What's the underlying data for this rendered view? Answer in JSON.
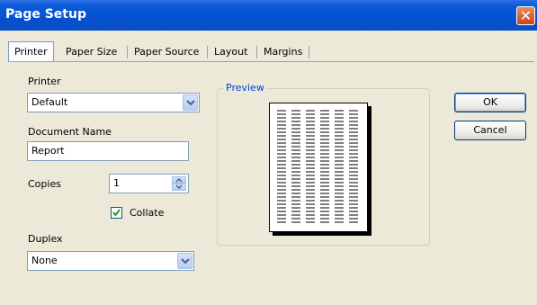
{
  "window": {
    "title": "Page Setup",
    "close_glyph": "✕"
  },
  "tabs": [
    {
      "label": "Printer",
      "active": true
    },
    {
      "label": "Paper Size",
      "active": false
    },
    {
      "label": "Paper Source",
      "active": false
    },
    {
      "label": "Layout",
      "active": false
    },
    {
      "label": "Margins",
      "active": false
    }
  ],
  "printer": {
    "label": "Printer",
    "selected": "Default"
  },
  "document_name": {
    "label": "Document Name",
    "value": "Report"
  },
  "copies": {
    "label": "Copies",
    "value": "1"
  },
  "collate": {
    "label": "Collate",
    "checked": true
  },
  "duplex": {
    "label": "Duplex",
    "selected": "None"
  },
  "preview": {
    "label": "Preview"
  },
  "buttons": {
    "ok": "OK",
    "cancel": "Cancel"
  },
  "colors": {
    "titlebar": "#0551d1",
    "dialog_bg": "#ece9d8",
    "groupbox_label": "#0046d5",
    "close_button": "#c8431a"
  }
}
